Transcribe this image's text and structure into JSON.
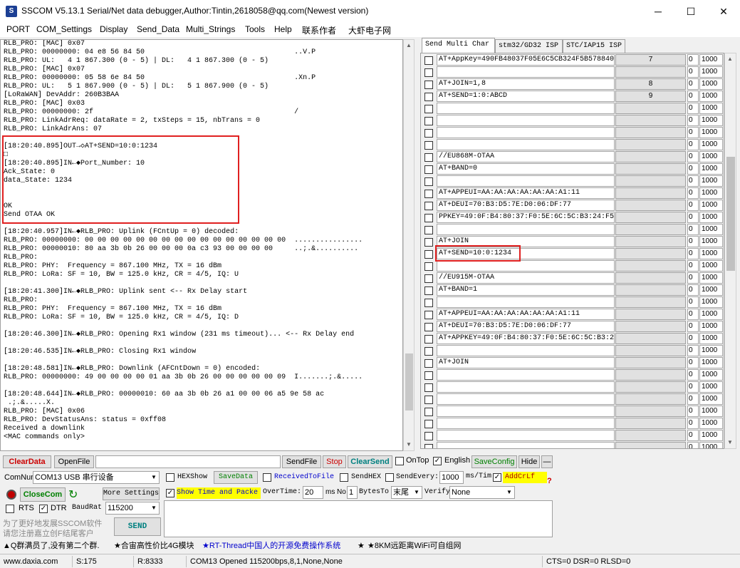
{
  "window": {
    "title": "SSCOM V5.13.1 Serial/Net data debugger,Author:Tintin,2618058@qq.com(Newest version)",
    "minimize": "─",
    "maximize": "☐",
    "close": "✕"
  },
  "menu": [
    "PORT",
    "COM_Settings",
    "Display",
    "Send_Data",
    "Multi_Strings",
    "Tools",
    "Help",
    "联系作者",
    "大虾电子网"
  ],
  "log_lines": [
    "RLB_PRO: [MAC] 0x07",
    "RLB_PRO: 00000000: 04 e8 56 84 50                                   ..V.P",
    "RLB_PRO: UL:   4 1 867.300 (0 - 5) | DL:   4 1 867.300 (0 - 5)",
    "RLB_PRO: [MAC] 0x07",
    "RLB_PRO: 00000000: 05 58 6e 84 50                                   .Xn.P",
    "RLB_PRO: UL:   5 1 867.900 (0 - 5) | DL:   5 1 867.900 (0 - 5)",
    "[LoRaWAN] DevAddr: 260B3BAA",
    "RLB_PRO: [MAC] 0x03",
    "RLB_PRO: 00000000: 2f                                               /",
    "RLB_PRO: LinkAdrReq: dataRate = 2, txSteps = 15, nbTrans = 0",
    "RLB_PRO: LinkAdrAns: 07",
    "",
    "[18:20:40.895]OUT→◇AT+SEND=10:0:1234",
    "□",
    "[18:20:40.895]IN←◆Port_Number: 10",
    "Ack_State: 0",
    "data_State: 1234",
    "",
    "",
    "OK",
    "Send OTAA OK",
    "",
    "[18:20:40.957]IN←◆RLB_PRO: Uplink (FCntUp = 0) decoded:",
    "RLB_PRO: 00000000: 00 00 00 00 00 00 00 00 00 00 00 00 00 00 00 00  ................",
    "RLB_PRO: 00000010: 80 aa 3b 0b 26 00 00 00 0a c3 93 00 00 00 00     ..;.&..........",
    "RLB_PRO:",
    "RLB_PRO: PHY:  Frequency = 867.100 MHz, TX = 16 dBm",
    "RLB_PRO: LoRa: SF = 10, BW = 125.0 kHz, CR = 4/5, IQ: U",
    "",
    "[18:20:41.300]IN←◆RLB_PRO: Uplink sent <-- Rx Delay start",
    "RLB_PRO:",
    "RLB_PRO: PHY:  Frequency = 867.100 MHz, TX = 16 dBm",
    "RLB_PRO: LoRa: SF = 10, BW = 125.0 kHz, CR = 4/5, IQ: D",
    "",
    "[18:20:46.300]IN←◆RLB_PRO: Opening Rx1 window (231 ms timeout)... <-- Rx Delay end",
    "",
    "[18:20:46.535]IN←◆RLB_PRO: Closing Rx1 window",
    "",
    "[18:20:48.581]IN←◆RLB_PRO: Downlink (AFCntDown = 0) encoded:",
    "RLB_PRO: 00000000: 49 00 00 00 00 01 aa 3b 0b 26 00 00 00 00 00 09  I.......;.&.....",
    "",
    "[18:20:48.644]IN←◆RLB_PRO: 00000010: 60 aa 3b 0b 26 a1 00 00 06 a5 9e 58 ac",
    " .;.&.....X.",
    "RLB_PRO: [MAC] 0x06",
    "RLB_PRO: DevStatusAns: status = 0xff08",
    "Received a downlink",
    "<MAC commands only>"
  ],
  "tabs": [
    "Send Multi Char",
    "stm32/GD32 ISP",
    "STC/IAP15 ISP"
  ],
  "multi_rows": [
    {
      "text": "AT+AppKey=490FB48037F05E6C5CB324F5B578840",
      "btn": "7",
      "num": "0",
      "delay": "1000"
    },
    {
      "text": "",
      "btn": "",
      "num": "0",
      "delay": "1000"
    },
    {
      "text": "AT+JOIN=1,8",
      "btn": "8",
      "num": "0",
      "delay": "1000"
    },
    {
      "text": "AT+SEND=1:0:ABCD",
      "btn": "9",
      "num": "0",
      "delay": "1000"
    },
    {
      "text": "",
      "btn": "",
      "num": "0",
      "delay": "1000"
    },
    {
      "text": "",
      "btn": "",
      "num": "0",
      "delay": "1000"
    },
    {
      "text": "",
      "btn": "",
      "num": "0",
      "delay": "1000"
    },
    {
      "text": "",
      "btn": "",
      "num": "0",
      "delay": "1000"
    },
    {
      "text": "//EU868M-OTAA",
      "btn": "",
      "num": "0",
      "delay": "1000"
    },
    {
      "text": "AT+BAND=0",
      "btn": "",
      "num": "0",
      "delay": "1000"
    },
    {
      "text": "",
      "btn": "",
      "num": "0",
      "delay": "1000"
    },
    {
      "text": "AT+APPEUI=AA:AA:AA:AA:AA:AA:A1:11",
      "btn": "",
      "num": "0",
      "delay": "1000"
    },
    {
      "text": "AT+DEUI=70:B3:D5:7E:D0:06:DF:77",
      "btn": "",
      "num": "0",
      "delay": "1000"
    },
    {
      "text": "PPKEY=49:0F:B4:80:37:F0:5E:6C:5C:B3:24:F5",
      "btn": "",
      "num": "0",
      "delay": "1000"
    },
    {
      "text": "",
      "btn": "",
      "num": "0",
      "delay": "1000"
    },
    {
      "text": "AT+JOIN",
      "btn": "",
      "num": "0",
      "delay": "1000"
    },
    {
      "text": "AT+SEND=10:0:1234",
      "btn": "",
      "num": "0",
      "delay": "1000"
    },
    {
      "text": "",
      "btn": "",
      "num": "0",
      "delay": "1000"
    },
    {
      "text": "//EU915M-OTAA",
      "btn": "",
      "num": "0",
      "delay": "1000"
    },
    {
      "text": "AT+BAND=1",
      "btn": "",
      "num": "0",
      "delay": "1000"
    },
    {
      "text": "",
      "btn": "",
      "num": "0",
      "delay": "1000"
    },
    {
      "text": "AT+APPEUI=AA:AA:AA:AA:AA:AA:A1:11",
      "btn": "",
      "num": "0",
      "delay": "1000"
    },
    {
      "text": "AT+DEUI=70:B3:D5:7E:D0:06:DF:77",
      "btn": "",
      "num": "0",
      "delay": "1000"
    },
    {
      "text": "AT+APPKEY=49:0F:B4:80:37:F0:5E:6C:5C:B3:2",
      "btn": "",
      "num": "0",
      "delay": "1000"
    },
    {
      "text": "",
      "btn": "",
      "num": "0",
      "delay": "1000"
    },
    {
      "text": "AT+JOIN",
      "btn": "",
      "num": "0",
      "delay": "1000"
    },
    {
      "text": "",
      "btn": "",
      "num": "0",
      "delay": "1000"
    },
    {
      "text": "",
      "btn": "",
      "num": "0",
      "delay": "1000"
    },
    {
      "text": "",
      "btn": "",
      "num": "0",
      "delay": "1000"
    },
    {
      "text": "",
      "btn": "",
      "num": "0",
      "delay": "1000"
    },
    {
      "text": "",
      "btn": "",
      "num": "0",
      "delay": "1000"
    },
    {
      "text": "",
      "btn": "",
      "num": "0",
      "delay": "1000"
    },
    {
      "text": "",
      "btn": "",
      "num": "0",
      "delay": "1000"
    }
  ],
  "row1": {
    "clear_data": "ClearData",
    "open_file": "OpenFile",
    "send_file": "SendFile",
    "stop": "Stop",
    "clear_send": "ClearSend",
    "ontop": "OnTop",
    "english": "English",
    "save_config": "SaveConfig",
    "hide": "Hide",
    "minus": "—"
  },
  "row2": {
    "comnum_label": "ComNum",
    "comnum_value": "COM13 USB 串行设备",
    "hexshow": "HEXShow",
    "save_data": "SaveData",
    "received_to_file": "ReceivedToFile",
    "sendhex": "SendHEX",
    "send_every": "SendEvery:",
    "every_value": "1000",
    "ms_tim": "ms/Tim",
    "add_crlf": "AddCrLf"
  },
  "row3": {
    "close_com": "CloseCom",
    "more_settings": "More Settings",
    "show_time": "Show Time and Packe",
    "overtime": "OverTime:",
    "overtime_value": "20",
    "ms": "ms",
    "no": "No",
    "no_value": "1",
    "bytes_to": "BytesTo",
    "tail": "末尾",
    "verify": "Verify",
    "verify_value": "None",
    "question": "?"
  },
  "row4": {
    "rts": "RTS",
    "dtr": "DTR",
    "baud_label": "BaudRat",
    "baud_value": "115200"
  },
  "promo": {
    "line1": "为了更好地发展SSCOM软件",
    "line2": "请您注册嘉立创F结尾客户",
    "send": "SEND"
  },
  "adbar": {
    "a": "▲Q群满员了,没有第二个群.",
    "b": "★合宙高性价比4G模块",
    "c": "★RT-Thread中国人的开源免费操作系统",
    "d": "★",
    "e": "★8KM远距离WiFi可自组网"
  },
  "statusbar": {
    "site": "www.daxia.com",
    "s": "S:175",
    "r": "R:8333",
    "port": "COM13 Opened  115200bps,8,1,None,None",
    "lines": "CTS=0 DSR=0 RLSD=0"
  },
  "colors": {
    "red_highlight": "#e02020",
    "addcrlf_bg": "#ffff00",
    "show_time_bg": "#ffff00",
    "clear_red": "#cc0000",
    "link_blue": "#0000cc",
    "savedata_green": "#008000"
  }
}
